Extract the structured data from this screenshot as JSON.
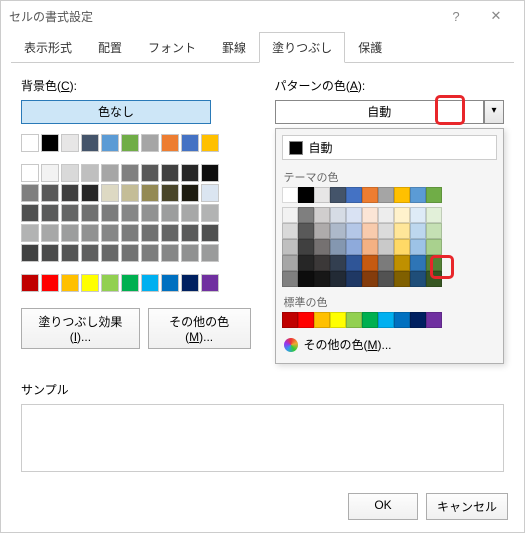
{
  "window": {
    "title": "セルの書式設定"
  },
  "tabs": [
    "表示形式",
    "配置",
    "フォント",
    "罫線",
    "塗りつぶし",
    "保護"
  ],
  "active_tab_index": 4,
  "left": {
    "label": "背景色(C):",
    "no_color": "色なし",
    "swatches_top": [
      "#ffffff",
      "#000000",
      "#e7e6e6",
      "#44546a",
      "#5b9bd5",
      "#70ad47",
      "#a5a5a5",
      "#ed7d31",
      "#4472c4",
      "#ffc000"
    ],
    "swatches_mid": [
      "#ffffff",
      "#f2f2f2",
      "#d9d9d9",
      "#bfbfbf",
      "#a6a6a6",
      "#808080",
      "#595959",
      "#404040",
      "#262626",
      "#0d0d0d",
      "#7f7f7f",
      "#595959",
      "#3f3f3f",
      "#262626",
      "#ddd9c3",
      "#c4bd97",
      "#948a54",
      "#494529",
      "#1d1b10",
      "#dbe5f1",
      "#4f5050",
      "#5a5b5b",
      "#656666",
      "#707171",
      "#7b7c7c",
      "#868787",
      "#919292",
      "#9c9d9d",
      "#a7a8a8",
      "#b2b3b3",
      "#b2b3b3",
      "#a7a8a8",
      "#9c9d9d",
      "#919292",
      "#868787",
      "#7b7c7c",
      "#707171",
      "#656666",
      "#5a5b5b",
      "#4f5050",
      "#404141",
      "#4a4b4b",
      "#545555",
      "#5e5f5f",
      "#686969",
      "#727373",
      "#7c7d7d",
      "#868787",
      "#909191",
      "#9a9b9b"
    ],
    "swatches_bottom": [
      "#c00000",
      "#ff0000",
      "#ffc000",
      "#ffff00",
      "#92d050",
      "#00b050",
      "#00b0f0",
      "#0070c0",
      "#002060",
      "#7030a0"
    ],
    "fill_effects_btn": "塗りつぶし効果(I)...",
    "more_colors_btn": "その他の色(M)..."
  },
  "right": {
    "label": "パターンの色(A):",
    "dropdown_value": "自動",
    "popup": {
      "auto_label": "自動",
      "theme_label": "テーマの色",
      "theme_base": [
        "#ffffff",
        "#000000",
        "#e7e6e6",
        "#44546a",
        "#4472c4",
        "#ed7d31",
        "#a5a5a5",
        "#ffc000",
        "#5b9bd5",
        "#70ad47"
      ],
      "theme_rows": [
        [
          "#f2f2f2",
          "#7f7f7f",
          "#d0cece",
          "#d6dce5",
          "#d9e2f3",
          "#fbe5d6",
          "#ededed",
          "#fff2cc",
          "#deebf7",
          "#e2f0d9"
        ],
        [
          "#d9d9d9",
          "#595959",
          "#aeabab",
          "#adb9ca",
          "#b4c7e7",
          "#f8cbad",
          "#dbdbdb",
          "#ffe699",
          "#bdd7ee",
          "#c5e0b4"
        ],
        [
          "#bfbfbf",
          "#404040",
          "#757171",
          "#8497b0",
          "#8eaadb",
          "#f4b183",
          "#c9c9c9",
          "#ffd966",
          "#9dc3e6",
          "#a9d18e"
        ],
        [
          "#a6a6a6",
          "#262626",
          "#3b3838",
          "#333f50",
          "#2f5597",
          "#c55a11",
          "#7b7b7b",
          "#bf9000",
          "#2e75b6",
          "#548235"
        ],
        [
          "#808080",
          "#0d0d0d",
          "#171717",
          "#222a35",
          "#1f3864",
          "#843c0c",
          "#525252",
          "#806000",
          "#1f4e79",
          "#385723"
        ]
      ],
      "standard_label": "標準の色",
      "standard": [
        "#c00000",
        "#ff0000",
        "#ffc000",
        "#ffff00",
        "#92d050",
        "#00b050",
        "#00b0f0",
        "#0070c0",
        "#002060",
        "#7030a0"
      ],
      "more_colors": "その他の色(M)..."
    }
  },
  "sample_label": "サンプル",
  "footer": {
    "ok": "OK",
    "cancel": "キャンセル"
  }
}
